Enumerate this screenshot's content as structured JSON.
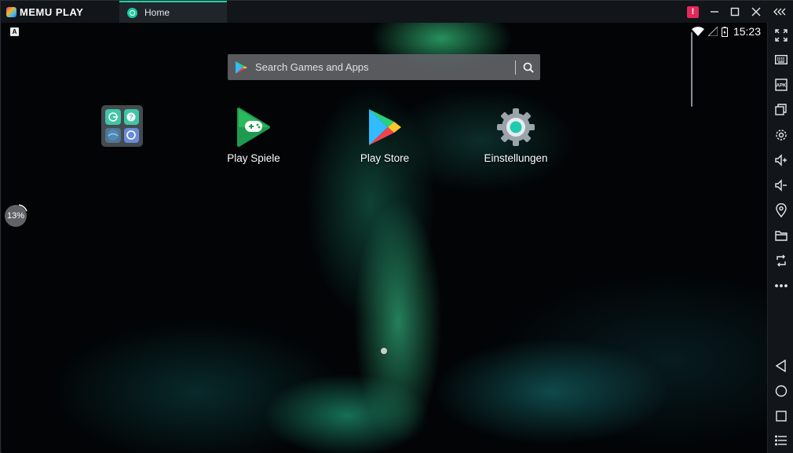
{
  "app": {
    "name": "MEMU PLAY",
    "tab_label": "Home",
    "alert_badge": "!"
  },
  "status_bar": {
    "left_indicator": "A",
    "time": "15:23"
  },
  "search": {
    "placeholder": "Search Games and Apps"
  },
  "apps": [
    {
      "label": "Play Spiele",
      "icon": "play-games-icon"
    },
    {
      "label": "Play Store",
      "icon": "play-store-icon"
    },
    {
      "label": "Einstellungen",
      "icon": "settings-gear-icon"
    }
  ],
  "folder": {
    "icon": "app-folder-icon"
  },
  "progress": {
    "label": "13%",
    "value": 0.13
  },
  "toolbar": {
    "items": [
      "fullscreen-icon",
      "keyboard-icon",
      "apk-icon",
      "multi-window-icon",
      "settings-icon",
      "volume-up-icon",
      "volume-down-icon",
      "location-icon",
      "folder-icon",
      "rotate-icon",
      "more-icon",
      "back-icon",
      "home-icon",
      "recent-apps-icon",
      "menu-icon"
    ],
    "apk_label": "APK"
  },
  "colors": {
    "accent": "#1fd1a4",
    "alert": "#e3285a",
    "titlebar": "#121519"
  }
}
